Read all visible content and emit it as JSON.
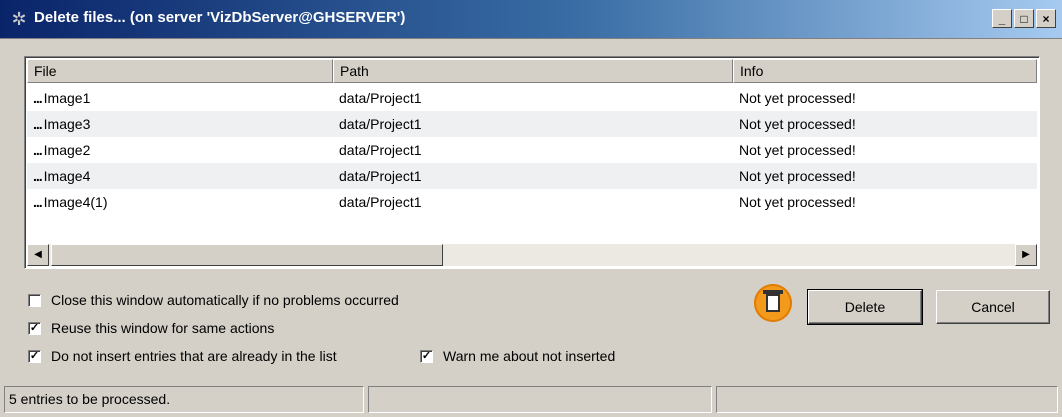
{
  "window": {
    "title": "Delete files... (on server 'VizDbServer@GHSERVER')",
    "icon": "gear-icon",
    "minimize": "_",
    "maximize": "□",
    "close": "×"
  },
  "list": {
    "columns": [
      "File",
      "Path",
      "Info"
    ],
    "rows": [
      {
        "file": "Image1",
        "path": "data/Project1",
        "info": "Not yet processed!"
      },
      {
        "file": "Image3",
        "path": "data/Project1",
        "info": "Not yet processed!"
      },
      {
        "file": "Image2",
        "path": "data/Project1",
        "info": "Not yet processed!"
      },
      {
        "file": "Image4",
        "path": "data/Project1",
        "info": "Not yet processed!"
      },
      {
        "file": "Image4(1)",
        "path": "data/Project1",
        "info": "Not yet processed!"
      }
    ],
    "row_prefix": "..."
  },
  "options": {
    "close_auto": {
      "label": "Close this window automatically if no problems occurred",
      "checked": false
    },
    "reuse": {
      "label": "Reuse this window for same actions",
      "checked": true
    },
    "no_duplicates": {
      "label": "Do not insert entries that are already in the list",
      "checked": true
    },
    "warn": {
      "label": "Warn me about not inserted",
      "checked": true
    }
  },
  "buttons": {
    "delete": "Delete",
    "cancel": "Cancel",
    "trash_icon": "trash-icon"
  },
  "status": {
    "left": "5 entries to be processed.",
    "middle": "",
    "right": ""
  },
  "colors": {
    "titlebar_start": "#0a246a",
    "titlebar_end": "#a6caf0",
    "trash_accent": "#f39a1c"
  }
}
